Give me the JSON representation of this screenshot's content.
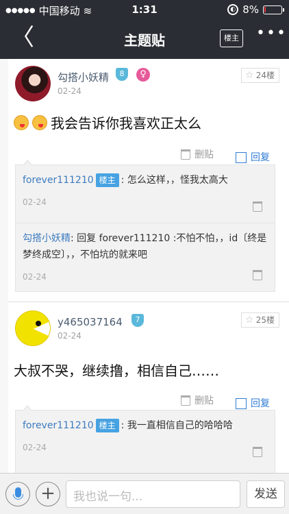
{
  "status_bar": {
    "carrier": "中国移动",
    "time": "1:31",
    "battery": "8%",
    "battery_level": 0.08
  },
  "nav": {
    "title": "主题贴",
    "louzhu_label": "楼主"
  },
  "posts": [
    {
      "username": "勾搭小妖精",
      "level": "8",
      "gender_icon": "female",
      "date": "02-24",
      "floor": "24楼",
      "content": "我会告诉你我喜欢正太么",
      "delete_label": "删贴",
      "reply_label": "回复",
      "replies": [
        {
          "name": "forever111210",
          "tag": "楼主",
          "text": ": 怎么这样，，怪我太高大",
          "date": "02-24"
        },
        {
          "name": "勾搭小妖精",
          "tag": "",
          "text": ": 回复 forever111210 :不怕不怕，，id〔终是梦终成空〕，，不怕坑的就来吧",
          "date": "02-24"
        }
      ]
    },
    {
      "username": "y465037164",
      "level": "7",
      "date": "02-24",
      "floor": "25楼",
      "content": "大叔不哭，继续撸，相信自己……",
      "delete_label": "删贴",
      "reply_label": "回复",
      "replies": [
        {
          "name": "forever111210",
          "tag": "楼主",
          "text": ": 我一直相信自己的哈哈哈",
          "date": "02-24"
        }
      ]
    }
  ],
  "input_bar": {
    "placeholder": "我也说一句...",
    "send_label": "发送"
  },
  "colors": {
    "nav_bg": "#2a2d33",
    "link_blue": "#2f7bd4",
    "tag_blue": "#47a2e2"
  }
}
